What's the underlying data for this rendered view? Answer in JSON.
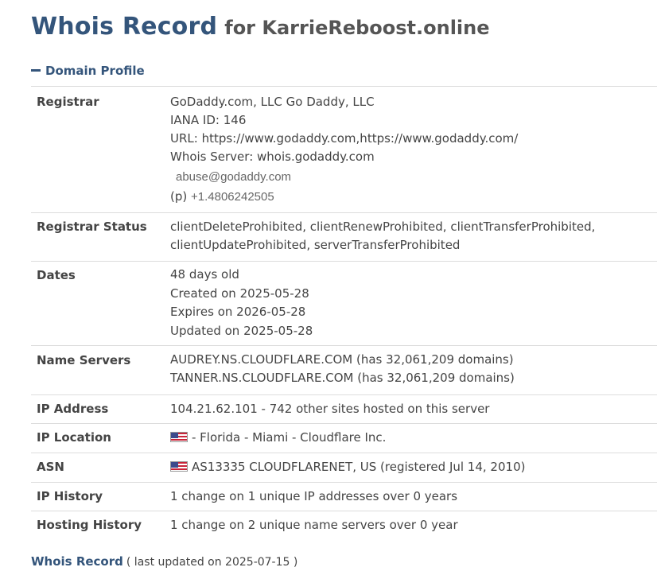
{
  "header": {
    "title": "Whois Record",
    "subtitle": "for KarrieReboost.online"
  },
  "section": {
    "label": "Domain Profile"
  },
  "rows": {
    "registrar": {
      "label": "Registrar",
      "name": "GoDaddy.com, LLC Go Daddy, LLC",
      "iana": "IANA ID: 146",
      "url": "URL: https://www.godaddy.com,https://www.godaddy.com/",
      "whois_server": "Whois Server: whois.godaddy.com",
      "email": "abuse@godaddy.com",
      "phone_prefix": "(p)",
      "phone": "+1.4806242505"
    },
    "status": {
      "label": "Registrar Status",
      "line1": "clientDeleteProhibited, clientRenewProhibited, clientTransferProhibited,",
      "line2": "clientUpdateProhibited, serverTransferProhibited"
    },
    "dates": {
      "label": "Dates",
      "age": "48 days old",
      "created": "Created on 2025-05-28",
      "expires": "Expires on 2026-05-28",
      "updated": "Updated on 2025-05-28"
    },
    "name_servers": {
      "label": "Name Servers",
      "ns1": "AUDREY.NS.CLOUDFLARE.COM (has 32,061,209 domains)",
      "ns2": "TANNER.NS.CLOUDFLARE.COM (has 32,061,209 domains)"
    },
    "ip_address": {
      "label": "IP Address",
      "value": "104.21.62.101 - 742 other sites hosted on this server"
    },
    "ip_location": {
      "label": "IP Location",
      "value": "- Florida - Miami - Cloudflare Inc.",
      "flag_icon": "us-flag-icon"
    },
    "asn": {
      "label": "ASN",
      "value": "AS13335 CLOUDFLARENET, US (registered Jul 14, 2010)",
      "flag_icon": "us-flag-icon"
    },
    "ip_history": {
      "label": "IP History",
      "value": "1 change on 1 unique IP addresses over 0 years"
    },
    "hosting_history": {
      "label": "Hosting History",
      "value": "1 change on 2 unique name servers over 0 year"
    }
  },
  "footer": {
    "link": "Whois Record",
    "note": "( last updated on 2025-07-15 )"
  },
  "colors": {
    "heading": "#34557b",
    "text": "#444444",
    "divider": "#dddddd"
  }
}
